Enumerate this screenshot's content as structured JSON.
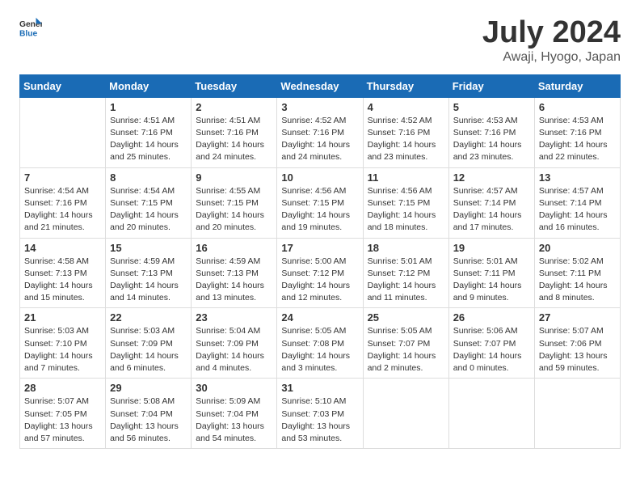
{
  "header": {
    "logo_general": "General",
    "logo_blue": "Blue",
    "month": "July 2024",
    "location": "Awaji, Hyogo, Japan"
  },
  "days_of_week": [
    "Sunday",
    "Monday",
    "Tuesday",
    "Wednesday",
    "Thursday",
    "Friday",
    "Saturday"
  ],
  "weeks": [
    [
      {
        "day": "",
        "info": ""
      },
      {
        "day": "1",
        "info": "Sunrise: 4:51 AM\nSunset: 7:16 PM\nDaylight: 14 hours\nand 25 minutes."
      },
      {
        "day": "2",
        "info": "Sunrise: 4:51 AM\nSunset: 7:16 PM\nDaylight: 14 hours\nand 24 minutes."
      },
      {
        "day": "3",
        "info": "Sunrise: 4:52 AM\nSunset: 7:16 PM\nDaylight: 14 hours\nand 24 minutes."
      },
      {
        "day": "4",
        "info": "Sunrise: 4:52 AM\nSunset: 7:16 PM\nDaylight: 14 hours\nand 23 minutes."
      },
      {
        "day": "5",
        "info": "Sunrise: 4:53 AM\nSunset: 7:16 PM\nDaylight: 14 hours\nand 23 minutes."
      },
      {
        "day": "6",
        "info": "Sunrise: 4:53 AM\nSunset: 7:16 PM\nDaylight: 14 hours\nand 22 minutes."
      }
    ],
    [
      {
        "day": "7",
        "info": "Sunrise: 4:54 AM\nSunset: 7:16 PM\nDaylight: 14 hours\nand 21 minutes."
      },
      {
        "day": "8",
        "info": "Sunrise: 4:54 AM\nSunset: 7:15 PM\nDaylight: 14 hours\nand 20 minutes."
      },
      {
        "day": "9",
        "info": "Sunrise: 4:55 AM\nSunset: 7:15 PM\nDaylight: 14 hours\nand 20 minutes."
      },
      {
        "day": "10",
        "info": "Sunrise: 4:56 AM\nSunset: 7:15 PM\nDaylight: 14 hours\nand 19 minutes."
      },
      {
        "day": "11",
        "info": "Sunrise: 4:56 AM\nSunset: 7:15 PM\nDaylight: 14 hours\nand 18 minutes."
      },
      {
        "day": "12",
        "info": "Sunrise: 4:57 AM\nSunset: 7:14 PM\nDaylight: 14 hours\nand 17 minutes."
      },
      {
        "day": "13",
        "info": "Sunrise: 4:57 AM\nSunset: 7:14 PM\nDaylight: 14 hours\nand 16 minutes."
      }
    ],
    [
      {
        "day": "14",
        "info": "Sunrise: 4:58 AM\nSunset: 7:13 PM\nDaylight: 14 hours\nand 15 minutes."
      },
      {
        "day": "15",
        "info": "Sunrise: 4:59 AM\nSunset: 7:13 PM\nDaylight: 14 hours\nand 14 minutes."
      },
      {
        "day": "16",
        "info": "Sunrise: 4:59 AM\nSunset: 7:13 PM\nDaylight: 14 hours\nand 13 minutes."
      },
      {
        "day": "17",
        "info": "Sunrise: 5:00 AM\nSunset: 7:12 PM\nDaylight: 14 hours\nand 12 minutes."
      },
      {
        "day": "18",
        "info": "Sunrise: 5:01 AM\nSunset: 7:12 PM\nDaylight: 14 hours\nand 11 minutes."
      },
      {
        "day": "19",
        "info": "Sunrise: 5:01 AM\nSunset: 7:11 PM\nDaylight: 14 hours\nand 9 minutes."
      },
      {
        "day": "20",
        "info": "Sunrise: 5:02 AM\nSunset: 7:11 PM\nDaylight: 14 hours\nand 8 minutes."
      }
    ],
    [
      {
        "day": "21",
        "info": "Sunrise: 5:03 AM\nSunset: 7:10 PM\nDaylight: 14 hours\nand 7 minutes."
      },
      {
        "day": "22",
        "info": "Sunrise: 5:03 AM\nSunset: 7:09 PM\nDaylight: 14 hours\nand 6 minutes."
      },
      {
        "day": "23",
        "info": "Sunrise: 5:04 AM\nSunset: 7:09 PM\nDaylight: 14 hours\nand 4 minutes."
      },
      {
        "day": "24",
        "info": "Sunrise: 5:05 AM\nSunset: 7:08 PM\nDaylight: 14 hours\nand 3 minutes."
      },
      {
        "day": "25",
        "info": "Sunrise: 5:05 AM\nSunset: 7:07 PM\nDaylight: 14 hours\nand 2 minutes."
      },
      {
        "day": "26",
        "info": "Sunrise: 5:06 AM\nSunset: 7:07 PM\nDaylight: 14 hours\nand 0 minutes."
      },
      {
        "day": "27",
        "info": "Sunrise: 5:07 AM\nSunset: 7:06 PM\nDaylight: 13 hours\nand 59 minutes."
      }
    ],
    [
      {
        "day": "28",
        "info": "Sunrise: 5:07 AM\nSunset: 7:05 PM\nDaylight: 13 hours\nand 57 minutes."
      },
      {
        "day": "29",
        "info": "Sunrise: 5:08 AM\nSunset: 7:04 PM\nDaylight: 13 hours\nand 56 minutes."
      },
      {
        "day": "30",
        "info": "Sunrise: 5:09 AM\nSunset: 7:04 PM\nDaylight: 13 hours\nand 54 minutes."
      },
      {
        "day": "31",
        "info": "Sunrise: 5:10 AM\nSunset: 7:03 PM\nDaylight: 13 hours\nand 53 minutes."
      },
      {
        "day": "",
        "info": ""
      },
      {
        "day": "",
        "info": ""
      },
      {
        "day": "",
        "info": ""
      }
    ]
  ]
}
